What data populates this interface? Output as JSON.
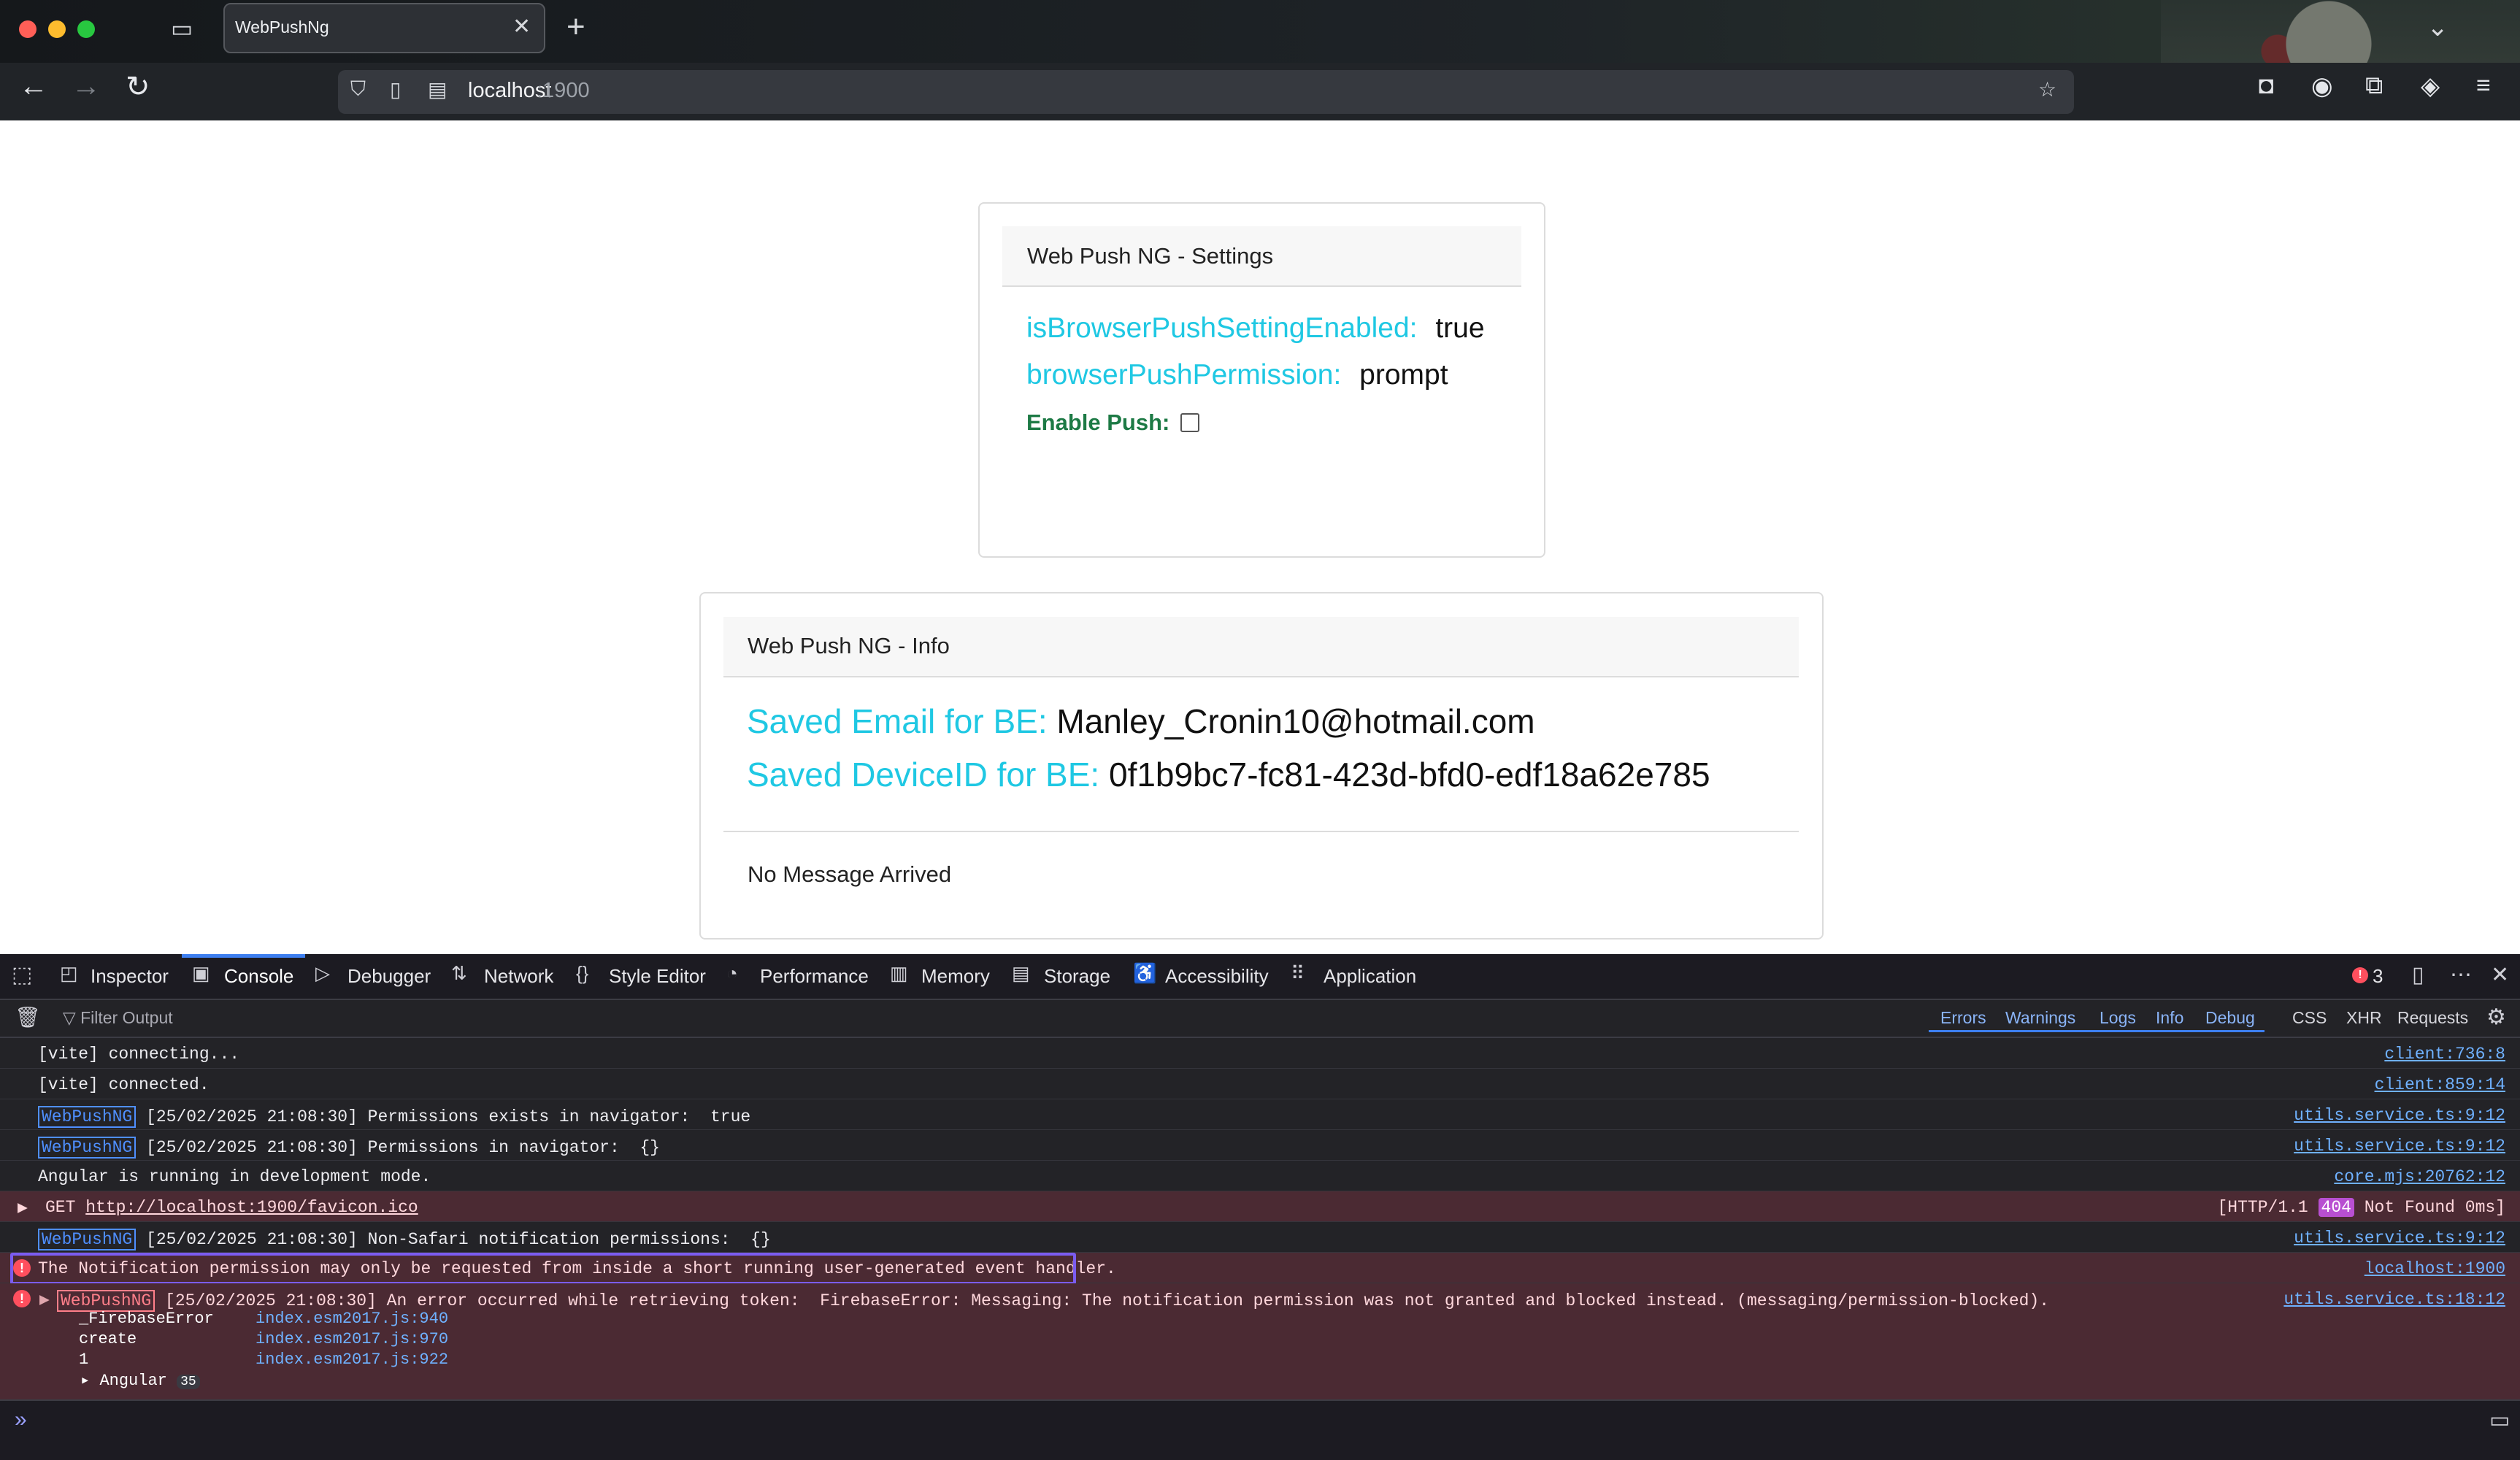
{
  "browser": {
    "tab_title": "WebPushNg",
    "url_host": "localhost",
    "url_port": ":1900"
  },
  "settings_card": {
    "header": "Web Push NG - Settings",
    "rows": [
      {
        "label": "isBrowserPushSettingEnabled:",
        "value": "true"
      },
      {
        "label": "browserPushPermission:",
        "value": "prompt"
      }
    ],
    "enable_push_label": "Enable Push:",
    "enable_push_checked": false
  },
  "info_card": {
    "header": "Web Push NG - Info",
    "email_label": "Saved Email for BE:",
    "email_value": "Manley_Cronin10@hotmail.com",
    "device_label": "Saved DeviceID for BE:",
    "device_value": "0f1b9bc7-fc81-423d-bfd0-edf18a62e785",
    "message": "No Message Arrived"
  },
  "devtools": {
    "tabs": [
      "Inspector",
      "Console",
      "Debugger",
      "Network",
      "Style Editor",
      "Performance",
      "Memory",
      "Storage",
      "Accessibility",
      "Application"
    ],
    "active_tab": "Console",
    "error_count": "3",
    "filter_placeholder": "Filter Output",
    "filters": [
      "Errors",
      "Warnings",
      "Logs",
      "Info",
      "Debug"
    ],
    "filters_plain": [
      "CSS",
      "XHR",
      "Requests"
    ],
    "logs": [
      {
        "text": "[vite] connecting...",
        "source": "client:736:8"
      },
      {
        "text": "[vite] connected.",
        "source": "client:859:14"
      },
      {
        "tag": "WebPushNG",
        "text": " [25/02/2025 21:08:30] Permissions exists in navigator:  true",
        "source": "utils.service.ts:9:12"
      },
      {
        "tag": "WebPushNG",
        "text": " [25/02/2025 21:08:30] Permissions in navigator:  {}",
        "source": "utils.service.ts:9:12"
      },
      {
        "text": "Angular is running in development mode.",
        "source": "core.mjs:20762:12"
      },
      {
        "method": "GET",
        "url": "http://localhost:1900/favicon.ico",
        "status_prefix": "[HTTP/1.1 ",
        "status_code": "404",
        "status_suffix": " Not Found 0ms]"
      },
      {
        "tag": "WebPushNG",
        "text": " [25/02/2025 21:08:30] Non-Safari notification permissions:  {}",
        "source": "utils.service.ts:9:12"
      },
      {
        "error": true,
        "text": "The Notification permission may only be requested from inside a short running user-generated event handler.",
        "source": "localhost:1900"
      },
      {
        "error": true,
        "tag": "WebPushNG",
        "text": " [25/02/2025 21:08:30] An error occurred while retrieving token:  FirebaseError: Messaging: The notification permission was not granted and blocked instead. (messaging/permission-blocked).",
        "source": "utils.service.ts:18:12"
      }
    ],
    "stack": [
      {
        "fn": "_FirebaseError",
        "loc": "index.esm2017.js:940"
      },
      {
        "fn": "create",
        "loc": "index.esm2017.js:970"
      },
      {
        "fn": "1",
        "loc": "index.esm2017.js:922"
      }
    ],
    "stack_group": "Angular",
    "stack_group_count": "35"
  }
}
